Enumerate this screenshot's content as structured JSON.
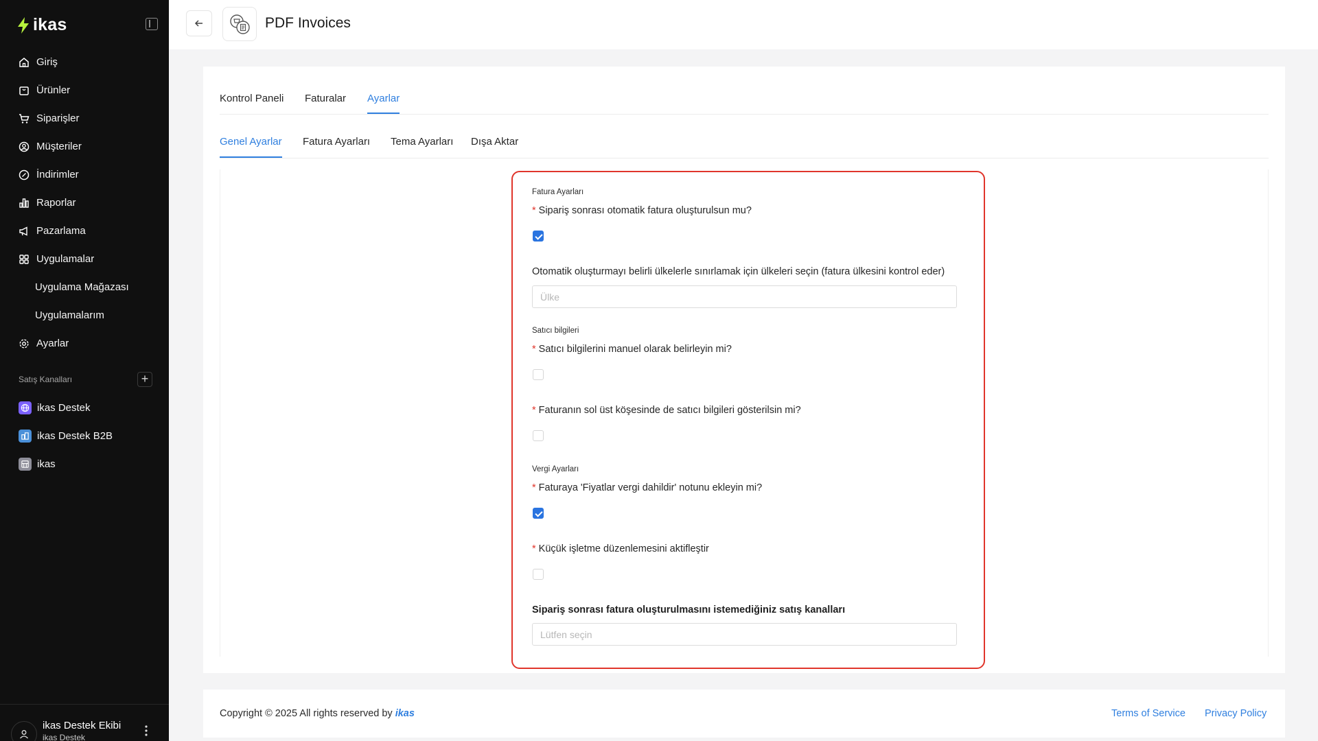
{
  "brand": {
    "name": "ikas"
  },
  "sidebar": {
    "items": [
      {
        "label": "Giriş",
        "icon": "home-icon"
      },
      {
        "label": "Ürünler",
        "icon": "box-icon"
      },
      {
        "label": "Siparişler",
        "icon": "cart-icon"
      },
      {
        "label": "Müşteriler",
        "icon": "user-circle-icon"
      },
      {
        "label": "İndirimler",
        "icon": "discount-icon"
      },
      {
        "label": "Raporlar",
        "icon": "chart-icon"
      },
      {
        "label": "Pazarlama",
        "icon": "megaphone-icon"
      },
      {
        "label": "Uygulamalar",
        "icon": "apps-grid-icon"
      },
      {
        "label": "Uygulama Mağazası",
        "icon": ""
      },
      {
        "label": "Uygulamalarım",
        "icon": ""
      },
      {
        "label": "Ayarlar",
        "icon": "gear-icon"
      }
    ],
    "sales_channels_title": "Satış Kanalları",
    "sales_channels": [
      {
        "label": "ikas Destek",
        "icon": "globe-icon",
        "color": "#7b61ff"
      },
      {
        "label": "ikas Destek B2B",
        "icon": "b2b-icon",
        "color": "#4a90d9"
      },
      {
        "label": "ikas",
        "icon": "store-icon",
        "color": "#8e8e99"
      }
    ],
    "user": {
      "name": "ikas Destek Ekibi",
      "store": "ikas Destek"
    }
  },
  "header": {
    "title": "PDF Invoices"
  },
  "tabs": [
    {
      "label": "Kontrol Paneli",
      "active": false
    },
    {
      "label": "Faturalar",
      "active": false
    },
    {
      "label": "Ayarlar",
      "active": true
    }
  ],
  "subtabs": [
    {
      "label": "Genel Ayarlar",
      "active": true
    },
    {
      "label": "Fatura Ayarları",
      "active": false
    },
    {
      "label": "Tema Ayarları",
      "active": false
    },
    {
      "label": "Dışa Aktar",
      "active": false
    }
  ],
  "form": {
    "invoice_settings_title": "Fatura Ayarları",
    "auto_invoice_q": "Sipariş sonrası otomatik fatura oluşturulsun mu?",
    "auto_invoice_checked": true,
    "country_q": "Otomatik oluşturmayı belirli ülkelerle sınırlamak için ülkeleri seçin (fatura ülkesini kontrol eder)",
    "country_placeholder": "Ülke",
    "seller_title": "Satıcı bilgileri",
    "seller_manual_q": "Satıcı bilgilerini manuel olarak belirleyin mi?",
    "seller_manual_checked": false,
    "seller_corner_q": "Faturanın sol üst köşesinde de satıcı bilgileri gösterilsin mi?",
    "seller_corner_checked": false,
    "tax_title": "Vergi Ayarları",
    "tax_note_q": "Faturaya 'Fiyatlar vergi dahildir' notunu ekleyin mi?",
    "tax_note_checked": true,
    "small_business_q": "Küçük işletme düzenlemesini aktifleştir",
    "small_business_checked": false,
    "excluded_channels_q": "Sipariş sonrası fatura oluşturulmasını istemediğiniz satış kanalları",
    "excluded_channels_placeholder": "Lütfen seçin",
    "required_mark": "*"
  },
  "footer": {
    "copyright": "Copyright © 2025 All rights reserved by",
    "brand": "ikas",
    "terms": "Terms of Service",
    "privacy": "Privacy Policy"
  },
  "colors": {
    "accent": "#2f7fdf",
    "highlight_border": "#e0352b",
    "sidebar_bg": "#101010"
  }
}
